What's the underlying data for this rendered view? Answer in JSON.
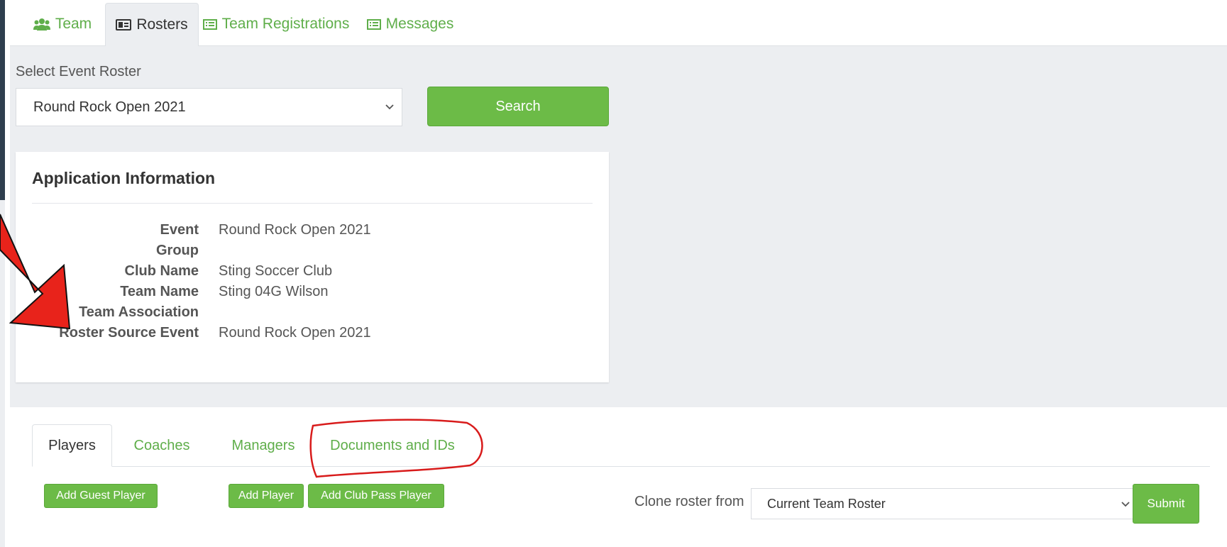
{
  "top_tabs": [
    {
      "label": "Team",
      "icon": "users-icon"
    },
    {
      "label": "Rosters",
      "icon": "id-card-icon"
    },
    {
      "label": "Team Registrations",
      "icon": "list-icon"
    },
    {
      "label": "Messages",
      "icon": "list-icon"
    }
  ],
  "active_top_tab": "Rosters",
  "event_roster": {
    "label": "Select Event Roster",
    "selected": "Round Rock Open 2021",
    "search_label": "Search"
  },
  "application_info": {
    "title": "Application Information",
    "rows": [
      {
        "label": "Event",
        "value": "Round Rock Open 2021"
      },
      {
        "label": "Group",
        "value": ""
      },
      {
        "label": "Club Name",
        "value": "Sting Soccer Club"
      },
      {
        "label": "Team Name",
        "value": "Sting 04G Wilson"
      },
      {
        "label": "Team Association",
        "value": ""
      },
      {
        "label": "Roster Source Event",
        "value": "Round Rock Open 2021"
      }
    ]
  },
  "roster_tabs": [
    {
      "label": "Players"
    },
    {
      "label": "Coaches"
    },
    {
      "label": "Managers"
    },
    {
      "label": "Documents and IDs"
    }
  ],
  "active_roster_tab": "Players",
  "actions": {
    "add_guest_player": "Add Guest Player",
    "add_player": "Add Player",
    "add_club_pass_player": "Add Club Pass Player"
  },
  "clone": {
    "label": "Clone roster from",
    "selected": "Current Team Roster",
    "submit_label": "Submit"
  },
  "colors": {
    "accent_green": "#6cbb47",
    "annotation_red": "#e8231b"
  }
}
